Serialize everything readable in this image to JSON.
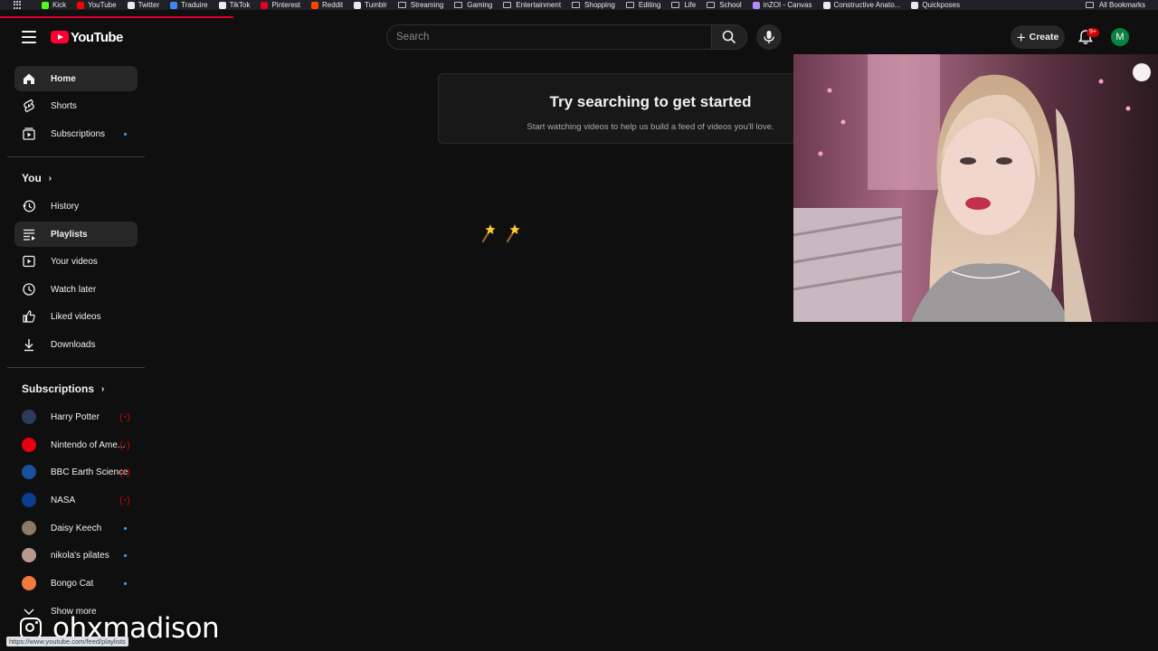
{
  "bookmarks": {
    "items": [
      {
        "label": "Kick",
        "color": "#53fc18"
      },
      {
        "label": "YouTube",
        "color": "#ff0000"
      },
      {
        "label": "Twitter",
        "color": "#e8eaed"
      },
      {
        "label": "Traduire",
        "color": "#4285f4"
      },
      {
        "label": "TikTok",
        "color": "#e8eaed"
      },
      {
        "label": "Pinterest",
        "color": "#e60023"
      },
      {
        "label": "Reddit",
        "color": "#ff4500"
      },
      {
        "label": "Tumblr",
        "color": "#e8eaed"
      }
    ],
    "folders": [
      "Streaming",
      "Gaming",
      "Entertainment",
      "Shopping",
      "Editing",
      "Life",
      "School"
    ],
    "more": [
      {
        "label": "inZOI - Canvas",
        "color": "#b18cff"
      },
      {
        "label": "Constructive Anato...",
        "color": "#e8eaed"
      },
      {
        "label": "Quickposes",
        "color": "#e8eaed"
      }
    ],
    "all_label": "All Bookmarks"
  },
  "masthead": {
    "logo_text": "YouTube",
    "search_placeholder": "Search",
    "create_label": "Create",
    "notification_count": "9+",
    "avatar_letter": "M"
  },
  "sidebar": {
    "main": [
      {
        "label": "Home",
        "icon": "home-icon",
        "active": true
      },
      {
        "label": "Shorts",
        "icon": "shorts-icon"
      },
      {
        "label": "Subscriptions",
        "icon": "subscriptions-icon",
        "dot": true
      }
    ],
    "you_heading": "You",
    "you": [
      {
        "label": "History",
        "icon": "history-icon"
      },
      {
        "label": "Playlists",
        "icon": "playlists-icon",
        "hover": true
      },
      {
        "label": "Your videos",
        "icon": "your-videos-icon"
      },
      {
        "label": "Watch later",
        "icon": "watch-later-icon"
      },
      {
        "label": "Liked videos",
        "icon": "like-icon"
      },
      {
        "label": "Downloads",
        "icon": "download-icon"
      }
    ],
    "subscriptions_heading": "Subscriptions",
    "subscriptions": [
      {
        "label": "Harry Potter",
        "avatar_color": "#2d3a5c",
        "live": true
      },
      {
        "label": "Nintendo of Ame...",
        "avatar_color": "#e60012",
        "live": true
      },
      {
        "label": "BBC Earth Science",
        "avatar_color": "#1a4f9c",
        "live": true
      },
      {
        "label": "NASA",
        "avatar_color": "#0b3d91",
        "live": true
      },
      {
        "label": "Daisy Keech",
        "avatar_color": "#8a7a66",
        "dot": true
      },
      {
        "label": "nikola's pilates",
        "avatar_color": "#b79a8d",
        "dot": true
      },
      {
        "label": "Bongo Cat",
        "avatar_color": "#f07b3c",
        "dot": true
      }
    ],
    "show_more_label": "Show more"
  },
  "main": {
    "empty_title": "Try searching to get started",
    "empty_subtitle": "Start watching videos to help us build a feed of videos you'll love."
  },
  "overlay": {
    "instagram_handle": "ohxmadison",
    "status_url": "https://www.youtube.com/feed/playlists"
  }
}
